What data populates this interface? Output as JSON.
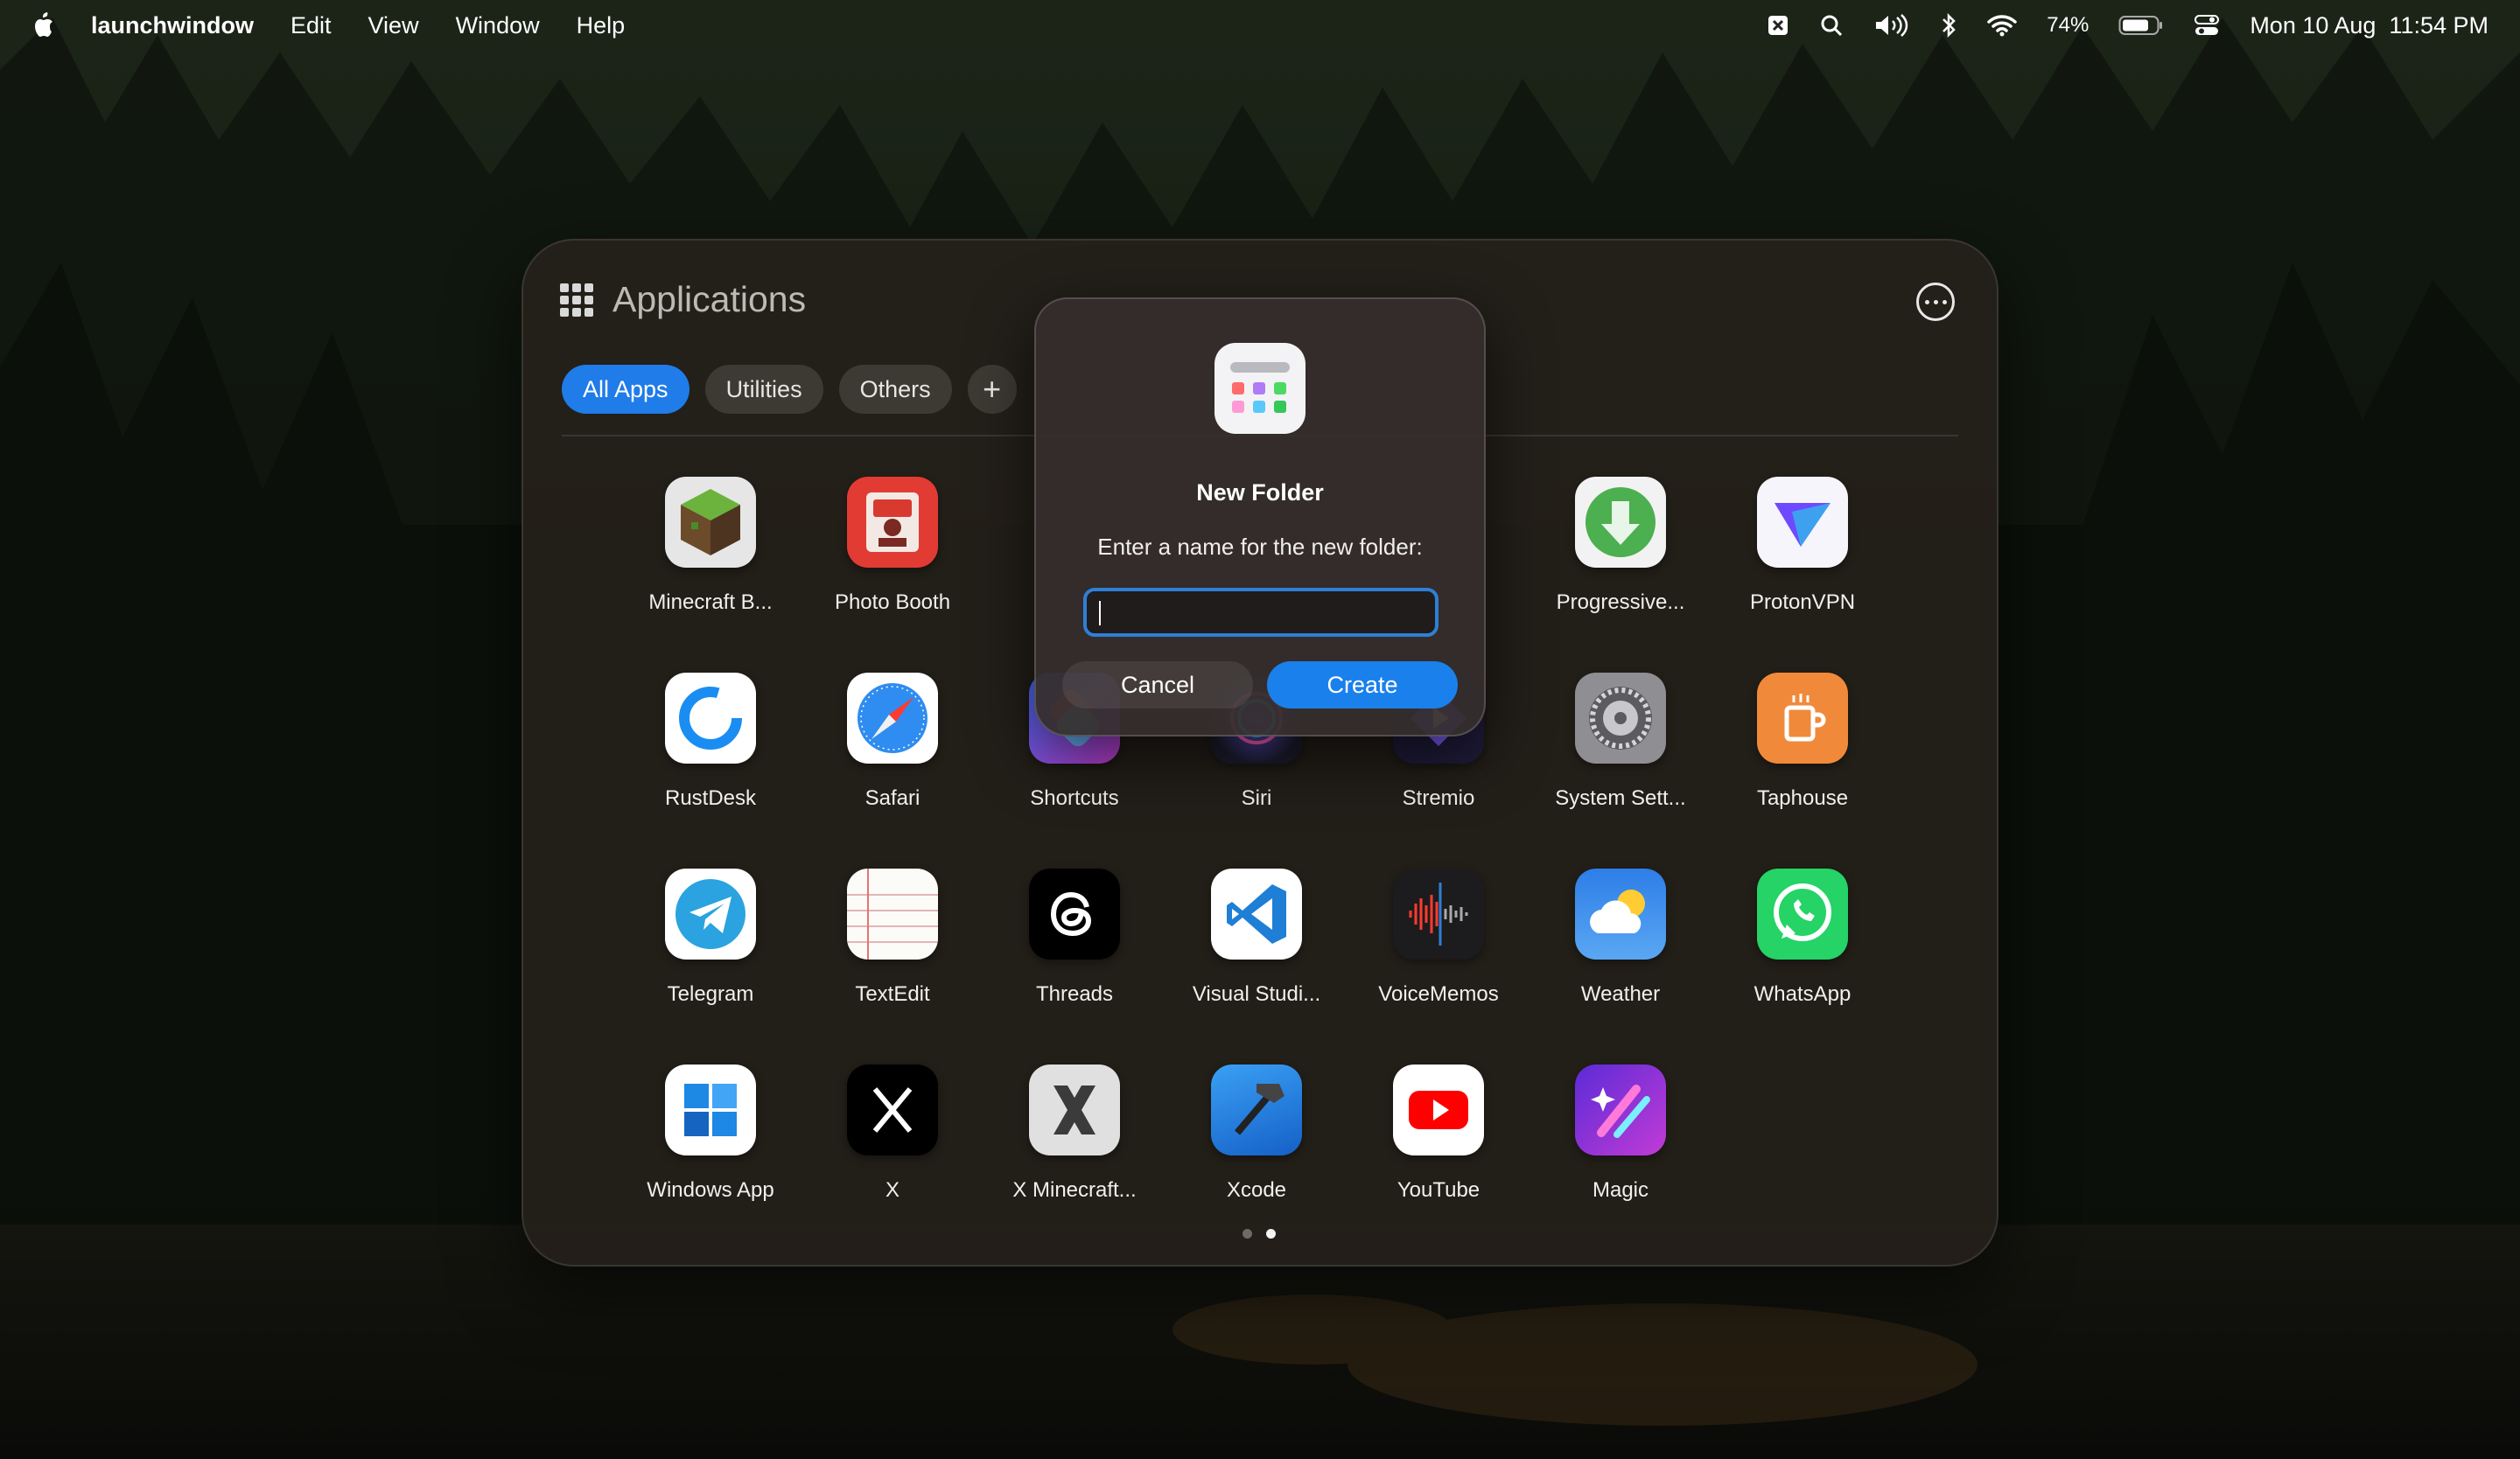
{
  "menubar": {
    "app_name": "launchwindow",
    "menus": [
      "Edit",
      "View",
      "Window",
      "Help"
    ],
    "battery_percent": "74%",
    "datetime": "Mon 10 Aug  11:54 PM"
  },
  "launcher": {
    "title": "Applications",
    "tabs": [
      "All Apps",
      "Utilities",
      "Others",
      "+"
    ],
    "active_tab": "All Apps",
    "apps": [
      {
        "label": "Minecraft B...",
        "icon": "minecraft-icon"
      },
      {
        "label": "Photo Booth",
        "icon": "photo-booth-icon"
      },
      {
        "label": "Progressive...",
        "icon": "progressive-downloaderer-icon"
      },
      {
        "label": "ProtonVPN",
        "icon": "protonvpn-icon"
      },
      {
        "label": "RustDesk",
        "icon": "rustdesk-icon"
      },
      {
        "label": "Safari",
        "icon": "safari-icon"
      },
      {
        "label": "Shortcuts",
        "icon": "shortcuts-icon"
      },
      {
        "label": "Siri",
        "icon": "siri-icon"
      },
      {
        "label": "Stremio",
        "icon": "stremio-icon"
      },
      {
        "label": "System Sett...",
        "icon": "system-settings-icon"
      },
      {
        "label": "Taphouse",
        "icon": "taphouse-icon"
      },
      {
        "label": "Telegram",
        "icon": "telegram-icon"
      },
      {
        "label": "TextEdit",
        "icon": "textedit-icon"
      },
      {
        "label": "Threads",
        "icon": "threads-icon"
      },
      {
        "label": "Visual Studi...",
        "icon": "vscode-icon"
      },
      {
        "label": "VoiceMemos",
        "icon": "voice-memos-icon"
      },
      {
        "label": "Weather",
        "icon": "weather-icon"
      },
      {
        "label": "WhatsApp",
        "icon": "whatsapp-icon"
      },
      {
        "label": "Windows App",
        "icon": "windows-app-icon"
      },
      {
        "label": "X",
        "icon": "x-icon"
      },
      {
        "label": "X Minecraft...",
        "icon": "x-minecraft-icon"
      },
      {
        "label": "Xcode",
        "icon": "xcode-icon"
      },
      {
        "label": "YouTube",
        "icon": "youtube-icon"
      },
      {
        "label": "Magic",
        "icon": "magic-icon"
      }
    ],
    "page_count": 2,
    "current_page": 2
  },
  "dialog": {
    "title": "New Folder",
    "message": "Enter a name for the new folder:",
    "input_value": "",
    "cancel_label": "Cancel",
    "create_label": "Create"
  },
  "colors": {
    "accent": "#1a80ec",
    "panel": "#26211b"
  }
}
